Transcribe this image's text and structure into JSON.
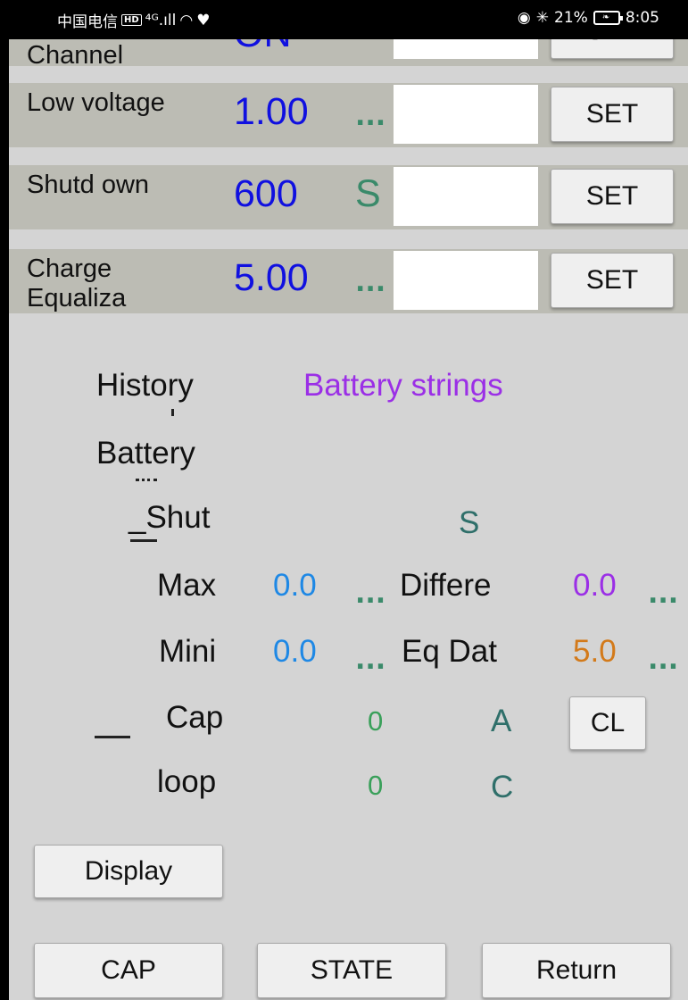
{
  "status_bar": {
    "carrier": "中国电信",
    "hd": "HD",
    "network": "⁴ᴳ.ıll",
    "battery_pct": "21%",
    "time": "8:05"
  },
  "settings_rows": [
    {
      "label": "Channel",
      "value": "ON",
      "unit": "",
      "button": "SET"
    },
    {
      "label": "Low voltage",
      "value": "1.00",
      "unit": "...",
      "button": "SET"
    },
    {
      "label": "Shutd own",
      "value": "600",
      "unit": "S",
      "button": "SET"
    },
    {
      "label": "Charge Equaliza",
      "value": "5.00",
      "unit": "...",
      "button": "SET"
    }
  ],
  "history": {
    "label": "History",
    "value": "Battery strings"
  },
  "battery_label": "Battery",
  "shut": {
    "label": "_Shut",
    "unit": "S"
  },
  "max": {
    "label": "Max",
    "value": "0.0",
    "diff_label": "Differe",
    "diff_value": "0.0"
  },
  "mini": {
    "label": "Mini",
    "value": "0.0",
    "eq_label": "Eq Dat",
    "eq_value": "5.0"
  },
  "cap": {
    "label": "Cap",
    "value": "0",
    "unit": "A",
    "button": "CL"
  },
  "loop": {
    "label": "loop",
    "value": "0",
    "unit": "C"
  },
  "ellipsis": "...",
  "buttons": {
    "display": "Display",
    "cap": "CAP",
    "state": "STATE",
    "return": "Return"
  }
}
